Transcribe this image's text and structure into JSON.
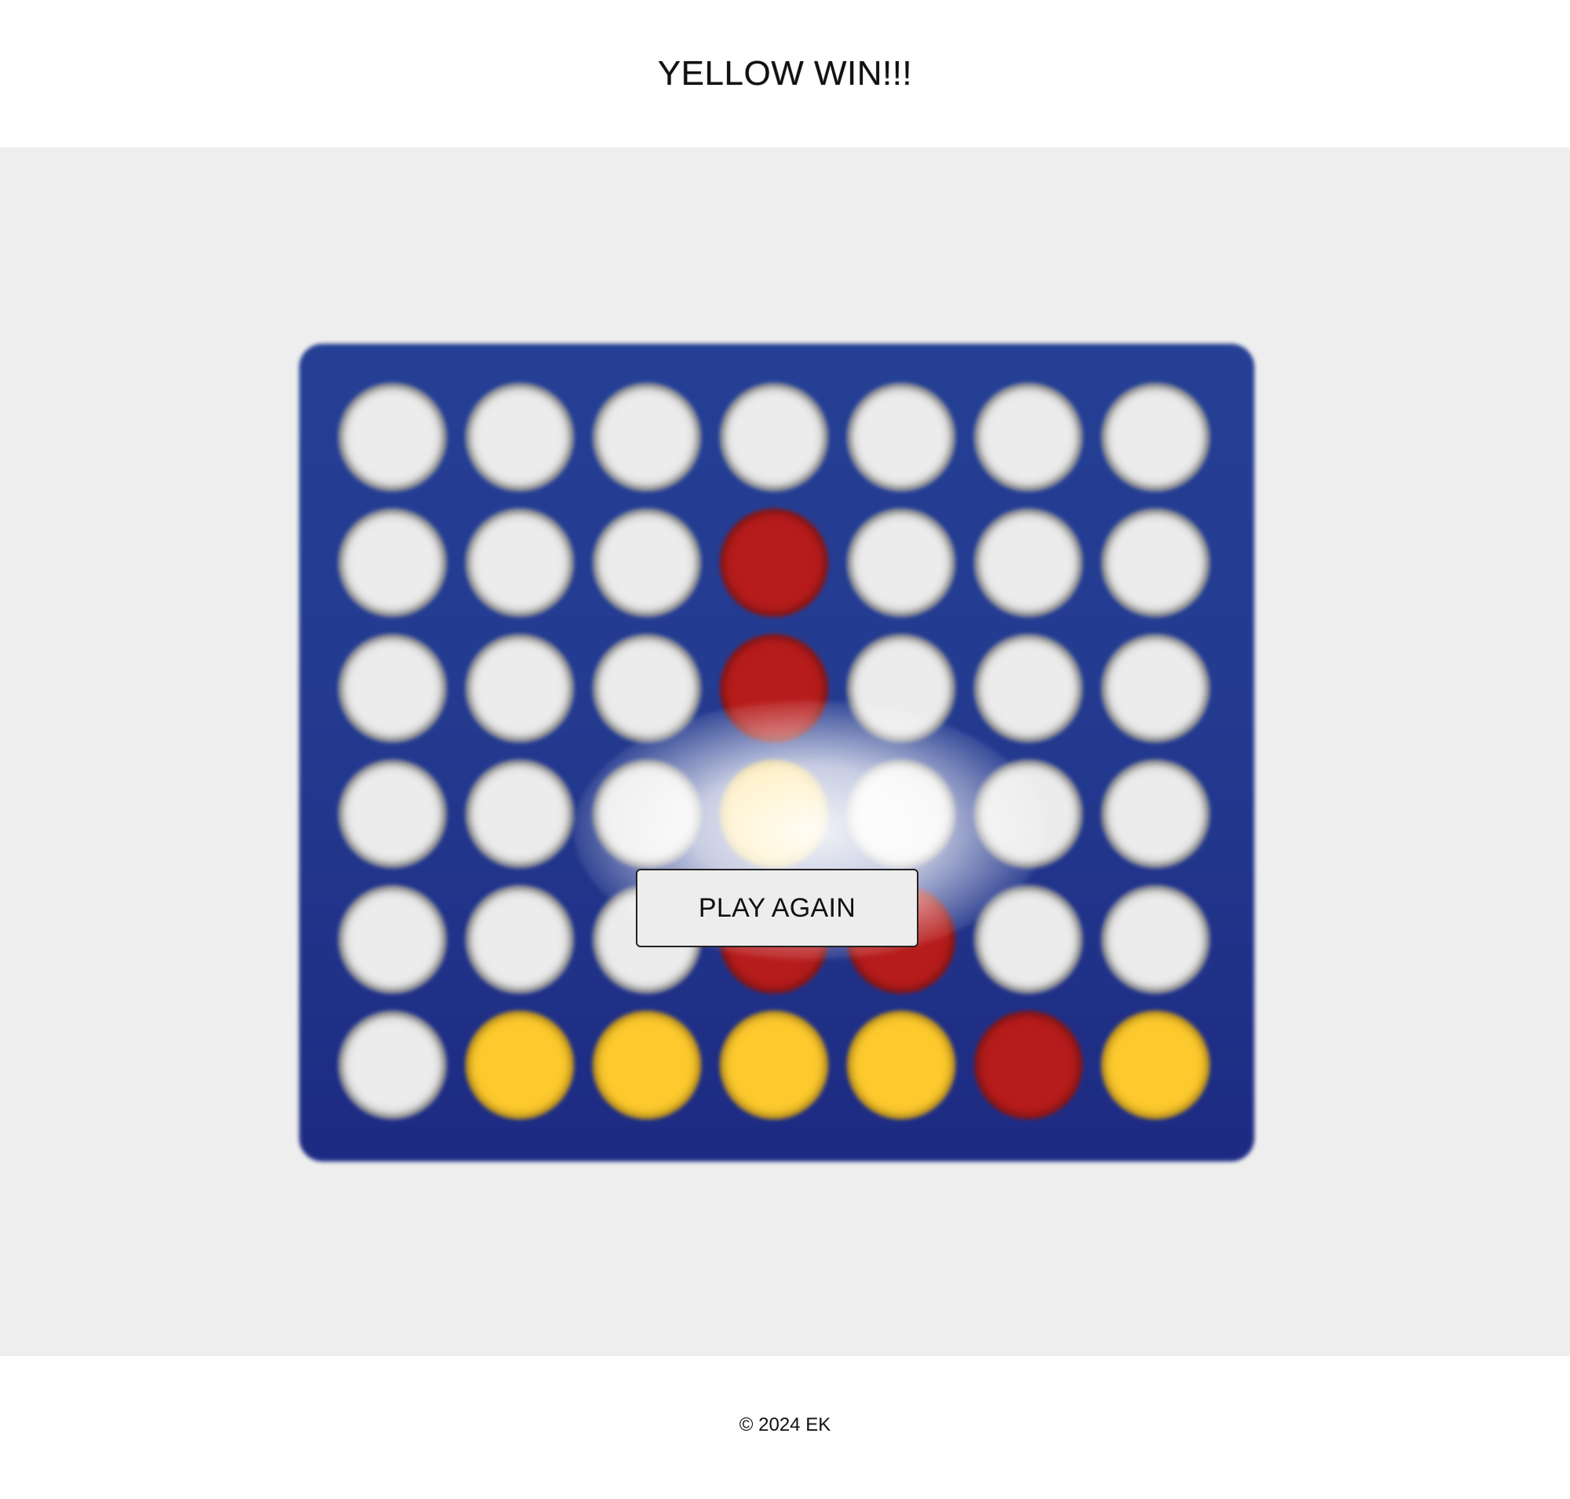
{
  "header": {
    "title": "YELLOW WIN!!!"
  },
  "board": {
    "columns": 7,
    "rows": 6,
    "grid": [
      [
        "empty",
        "empty",
        "empty",
        "empty",
        "empty",
        "empty",
        "empty"
      ],
      [
        "empty",
        "empty",
        "empty",
        "red",
        "empty",
        "empty",
        "empty"
      ],
      [
        "empty",
        "empty",
        "empty",
        "red",
        "empty",
        "empty",
        "empty"
      ],
      [
        "empty",
        "empty",
        "empty",
        "yellow",
        "empty",
        "empty",
        "empty"
      ],
      [
        "empty",
        "empty",
        "empty",
        "red",
        "red",
        "empty",
        "empty"
      ],
      [
        "empty",
        "yellow",
        "yellow",
        "yellow",
        "yellow",
        "red",
        "yellow"
      ]
    ],
    "colors": {
      "board": "#233a8f",
      "empty": "#ececec",
      "red": "#b71c1c",
      "yellow": "#fdca2e"
    }
  },
  "overlay": {
    "play_again_label": "PLAY AGAIN"
  },
  "footer": {
    "copyright": "© 2024 EK"
  }
}
